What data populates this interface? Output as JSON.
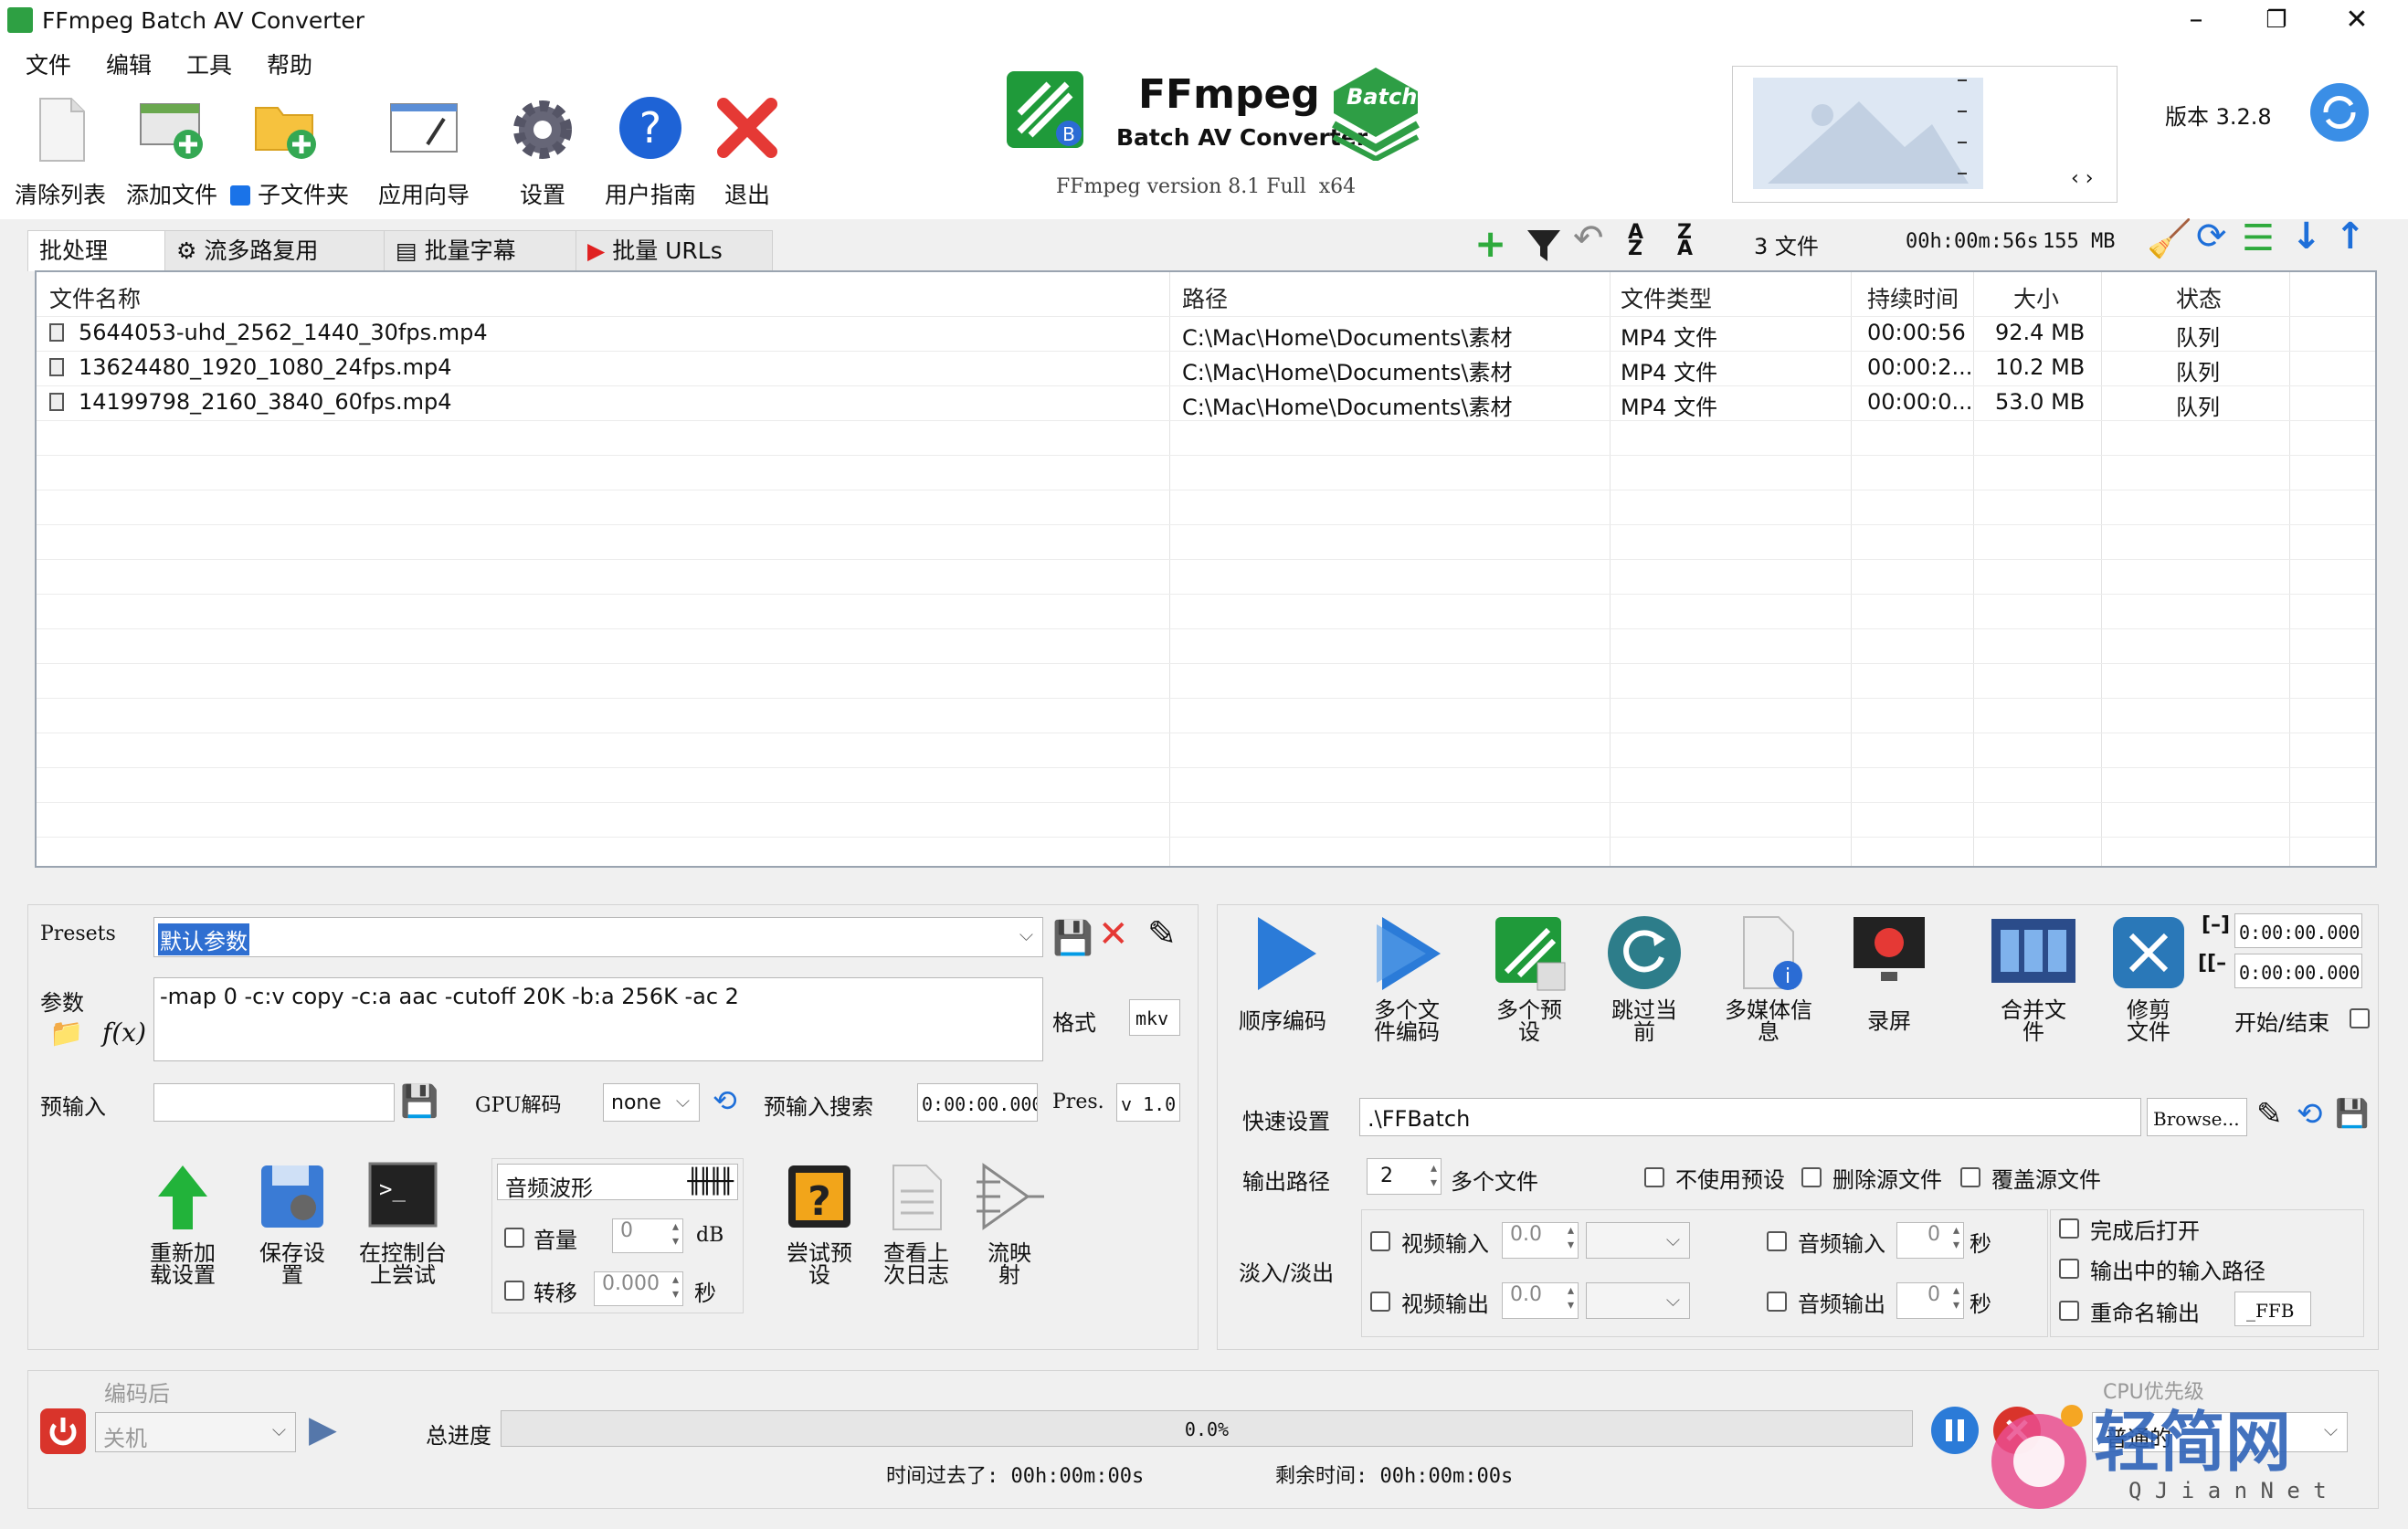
{
  "window": {
    "title": "FFmpeg Batch AV Converter"
  },
  "menu": [
    "文件",
    "编辑",
    "工具",
    "帮助"
  ],
  "toolbar": {
    "clear_list": "清除列表",
    "add_files": "添加文件",
    "subfolders": "子文件夹",
    "wizard": "应用向导",
    "settings": "设置",
    "user_guide": "用户指南",
    "exit": "退出"
  },
  "logo": {
    "name": "FFmpeg",
    "subtitle": "Batch AV Converter",
    "badge": "Batch",
    "ffmpeg_version": "FFmpeg version 8.1 Full  x64"
  },
  "version": "版本 3.2.8",
  "tabs": [
    "批处理",
    "流多路复用",
    "批量字幕",
    "批量 URLs"
  ],
  "list_summary": {
    "files": "3 文件",
    "duration": "00h:00m:56s",
    "size": "155 MB"
  },
  "columns": [
    "文件名称",
    "路径",
    "文件类型",
    "持续时间",
    "大小",
    "状态"
  ],
  "files": [
    {
      "name": "5644053-uhd_2562_1440_30fps.mp4",
      "path": "C:\\Mac\\Home\\Documents\\素材",
      "type": "MP4 文件",
      "duration": "00:00:56",
      "size": "92.4 MB",
      "status": "队列"
    },
    {
      "name": "13624480_1920_1080_24fps.mp4",
      "path": "C:\\Mac\\Home\\Documents\\素材",
      "type": "MP4 文件",
      "duration": "00:00:2...",
      "size": "10.2 MB",
      "status": "队列"
    },
    {
      "name": "14199798_2160_3840_60fps.mp4",
      "path": "C:\\Mac\\Home\\Documents\\素材",
      "type": "MP4 文件",
      "duration": "00:00:0...",
      "size": "53.0 MB",
      "status": "队列"
    }
  ],
  "presets": {
    "label": "Presets",
    "value": "默认参数",
    "params_label": "参数",
    "params": "-map 0 -c:v copy -c:a aac -cutoff 20K -b:a 256K -ac 2",
    "format_label": "格式",
    "format": "mkv",
    "pre_input_label": "预输入",
    "gpu_label": "GPU解码",
    "gpu_value": "none",
    "pre_search_label": "预输入搜索",
    "pre_search_value": "0:00:00.000",
    "pres_label": "Pres.",
    "pres_value": "v 1.0"
  },
  "left_actions": {
    "reload": "重新加载设置",
    "save": "保存设置",
    "console": "在控制台上尝试",
    "test_preset": "尝试预设",
    "view_log": "查看上次日志",
    "stream_map": "流映射"
  },
  "audio": {
    "waveform": "音频波形",
    "volume": "音量",
    "volume_val": "0",
    "db": "dB",
    "shift": "转移",
    "shift_val": "0.000",
    "sec": "秒"
  },
  "encode_actions": {
    "sequential": "顺序编码",
    "multi_file": "多个文件编码",
    "multi_preset": "多个预设",
    "skip_current": "跳过当前",
    "media_info": "多媒体信息",
    "record": "录屏",
    "merge": "合并文件",
    "trim": "修剪文件"
  },
  "timerange": {
    "start": "0:00:00.000",
    "end": "0:00:00.000",
    "start_end_label": "开始/结束"
  },
  "quick": {
    "quick_label": "快速设置",
    "path_value": ".\\FFBatch",
    "browse": "Browse...",
    "output_label": "输出路径",
    "multi_count": "2",
    "multi_files": "多个文件",
    "no_preset": "不使用预设",
    "delete_source": "删除源文件",
    "overwrite_source": "覆盖源文件"
  },
  "fade": {
    "label": "淡入/淡出",
    "video_in": "视频输入",
    "video_out": "视频输出",
    "audio_in": "音频输入",
    "audio_out": "音频输出",
    "v_val": "0.0",
    "a_val": "0",
    "sec": "秒"
  },
  "after_opts": {
    "open_done": "完成后打开",
    "input_path": "输出中的输入路径",
    "rename": "重命名输出",
    "suffix": "_FFB"
  },
  "status": {
    "after_label": "编码后",
    "after_value": "关机",
    "total_label": "总进度",
    "progress_text": "0.0%",
    "progress": 0.0,
    "elapsed": "时间过去了: 00h:00m:00s",
    "remaining": "剩余时间: 00h:00m:00s",
    "cpu_label": "CPU优先级",
    "cpu_value": "普通的"
  },
  "watermark": {
    "text": "轻简网",
    "sub": "Q J i a n N e t"
  }
}
